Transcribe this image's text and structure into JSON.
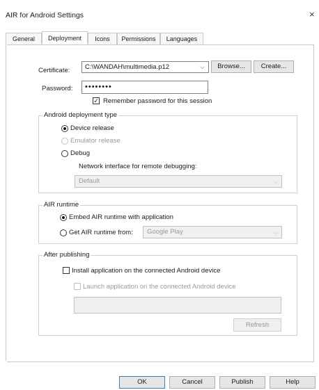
{
  "window": {
    "title": "AIR for Android Settings",
    "close_glyph": "×"
  },
  "tabs": [
    {
      "label": "General",
      "active": false
    },
    {
      "label": "Deployment",
      "active": true
    },
    {
      "label": "Icons",
      "active": false
    },
    {
      "label": "Permissions",
      "active": false
    },
    {
      "label": "Languages",
      "active": false
    }
  ],
  "certificate": {
    "label": "Certificate:",
    "value": "C:\\WANDAH\\multimedia.p12",
    "browse_label": "Browse...",
    "create_label": "Create..."
  },
  "password": {
    "label": "Password:",
    "value": "••••••••",
    "remember_label": "Remember password for this session",
    "remember_checked": true
  },
  "deployment_type": {
    "title": "Android deployment type",
    "options": [
      {
        "label": "Device release",
        "selected": true,
        "enabled": true
      },
      {
        "label": "Emulator release",
        "selected": false,
        "enabled": false
      },
      {
        "label": "Debug",
        "selected": false,
        "enabled": true
      }
    ],
    "network_label": "Network interface for remote debugging:",
    "network_value": "Default"
  },
  "air_runtime": {
    "title": "AIR runtime",
    "embed_label": "Embed AIR runtime with application",
    "get_label": "Get AIR runtime from:",
    "source_value": "Google Play"
  },
  "after_publishing": {
    "title": "After publishing",
    "install_label": "Install application on the connected Android device",
    "launch_label": "Launch application on the connected Android device",
    "refresh_label": "Refresh"
  },
  "footer": {
    "ok_label": "OK",
    "cancel_label": "Cancel",
    "publish_label": "Publish",
    "help_label": "Help"
  },
  "icons": {
    "checked": "✓",
    "dropdown": "⌵"
  }
}
